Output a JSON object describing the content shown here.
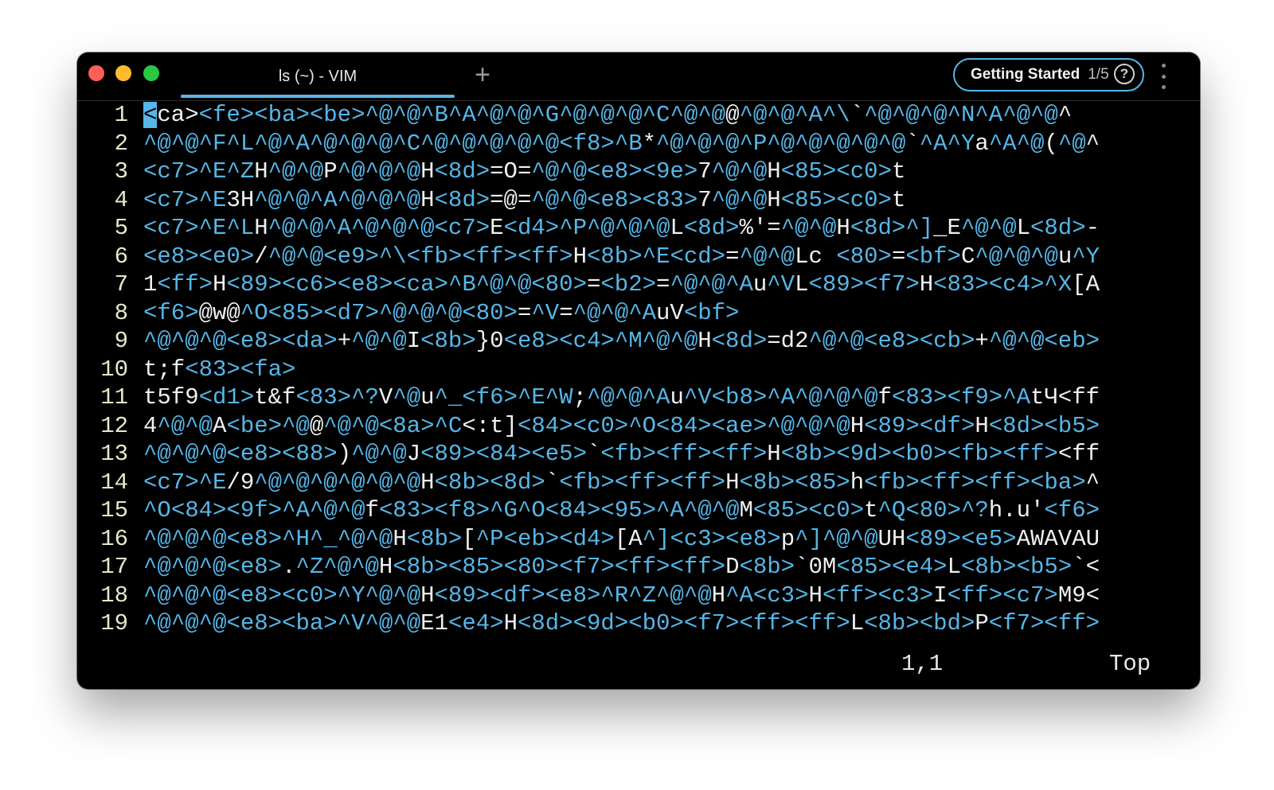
{
  "window": {
    "tab_title": "ls (~) - VIM",
    "new_tab_label": "+",
    "getting_started_label": "Getting Started",
    "getting_started_count": "1/5",
    "help_label": "?"
  },
  "editor": {
    "lines": [
      {
        "num": "1",
        "cursor": "<",
        "text": "ca><fe><ba><be>^@^@^B^A^@^@^G^@^@^@^C^@^@@^@^@^A^\\`^@^@^@^N^A^@^@^"
      },
      {
        "num": "2",
        "cursor": "",
        "text": "^@^@^F^L^@^A^@^@^@^C^@^@^@^@^@<f8>^B*^@^@^@^P^@^@^@^@^@`^A^Ya^A^@(^@^"
      },
      {
        "num": "3",
        "cursor": "",
        "text": "<c7>^E^ZH^@^@P^@^@^@H<8d>=O=^@^@<e8><9e>7^@^@H<85><c0>t"
      },
      {
        "num": "4",
        "cursor": "",
        "text": "<c7>^E3H^@^@^A^@^@^@H<8d>=@=^@^@<e8><83>7^@^@H<85><c0>t"
      },
      {
        "num": "5",
        "cursor": "",
        "text": "<c7>^E^LH^@^@^A^@^@^@<c7>E<d4>^P^@^@^@L<8d>%'=^@^@H<8d>^]_E^@^@L<8d>-"
      },
      {
        "num": "6",
        "cursor": "",
        "text": "<e8><e0>/^@^@<e9>^\\<fb><ff><ff>H<8b>^E<cd>=^@^@Lc <80>=<bf>C^@^@^@u^Y"
      },
      {
        "num": "7",
        "cursor": "",
        "text": "1<ff>H<89><c6><e8><ca>^B^@^@<80>=<b2>=^@^@^Au^VL<89><f7>H<83><c4>^X[A"
      },
      {
        "num": "8",
        "cursor": "",
        "text": "<f6>@w@^O<85><d7>^@^@^@<80>=^V=^@^@^AuV<bf>"
      },
      {
        "num": "9",
        "cursor": "",
        "text": "^@^@^@<e8><da>+^@^@I<8b>}0<e8><c4>^M^@^@H<8d>=d2^@^@<e8><cb>+^@^@<eb>"
      },
      {
        "num": "10",
        "cursor": "",
        "text": "t;f<83><fa>"
      },
      {
        "num": "11",
        "cursor": "",
        "text": "t5f9<d1>t&f<83>^?V^@u^_<f6>^E^W;^@^@^Au^V<b8>^A^@^@^@f<83><f9>^AtЧ<ff"
      },
      {
        "num": "12",
        "cursor": "",
        "text": "4^@^@A<be>^@@^@^@<8a>^C<:t]<84><c0>^O<84><ae>^@^@^@H<89><df>H<8d><b5>"
      },
      {
        "num": "13",
        "cursor": "",
        "text": "^@^@^@<e8><88>)^@^@J<89><84><e5>`<fb><ff><ff>H<8b><9d><b0><fb><ff><ff"
      },
      {
        "num": "14",
        "cursor": "",
        "text": "<c7>^E/9^@^@^@^@^@^@H<8b><8d>`<fb><ff><ff>H<8b><85>h<fb><ff><ff><ba>^"
      },
      {
        "num": "15",
        "cursor": "",
        "text": "^O<84><9f>^A^@^@f<83><f8>^G^O<84><95>^A^@^@M<85><c0>t^Q<80>^?h.u'<f6>"
      },
      {
        "num": "16",
        "cursor": "",
        "text": "^@^@^@<e8>^H^_^@^@H<8b>[^P<eb><d4>[A^]<c3><e8>p^]^@^@UH<89><e5>AWAVAU"
      },
      {
        "num": "17",
        "cursor": "",
        "text": "^@^@^@<e8>.^Z^@^@H<8b><85><80><f7><ff><ff>D<8b>`0M<85><e4>L<8b><b5>`<"
      },
      {
        "num": "18",
        "cursor": "",
        "text": "^@^@^@<e8><c0>^Y^@^@H<89><df><e8>^R^Z^@^@H^A<c3>H<ff><c3>I<ff><c7>M9<"
      },
      {
        "num": "19",
        "cursor": "",
        "text": "^@^@^@<e8><ba>^V^@^@E1<e4>H<8d><9d><b0><f7><ff><ff>L<8b><bd>P<f7><ff>"
      }
    ]
  },
  "status": {
    "position": "1,1",
    "scroll": "Top"
  },
  "colors": {
    "special_text": "#56b6e8",
    "line_numbers": "#e8e8c8",
    "background": "#000000"
  }
}
